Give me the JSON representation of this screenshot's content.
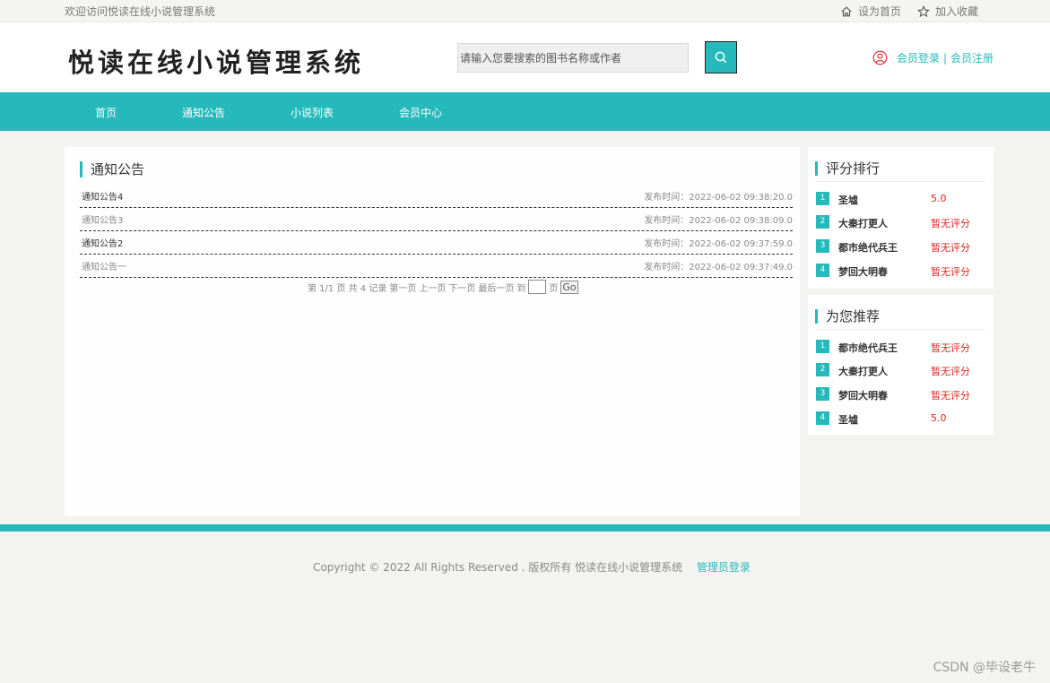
{
  "topbar": {
    "welcome": "欢迎访问悦读在线小说管理系统",
    "set_home": "设为首页",
    "bookmark": "加入收藏"
  },
  "header": {
    "logo": "悦读在线小说管理系统",
    "search_placeholder": "请输入您要搜索的图书名称或作者",
    "login": "会员登录",
    "separator": "|",
    "register": "会员注册"
  },
  "nav": {
    "items": [
      {
        "label": "首页"
      },
      {
        "label": "通知公告"
      },
      {
        "label": "小说列表"
      },
      {
        "label": "会员中心"
      }
    ]
  },
  "main": {
    "title": "通知公告",
    "notices": [
      {
        "title": "通知公告4",
        "time": "发布时间：2022-06-02 09:38:20.0",
        "color": "#333333"
      },
      {
        "title": "通知公告3",
        "time": "发布时间：2022-06-02 09:38:09.0",
        "color": "#888888"
      },
      {
        "title": "通知公告2",
        "time": "发布时间：2022-06-02 09:37:59.0",
        "color": "#333333"
      },
      {
        "title": "通知公告一",
        "time": "发布时间：2022-06-02 09:37:49.0",
        "color": "#888888"
      }
    ],
    "pager": {
      "info": "第 1/1 页 共 4 记录",
      "first": "第一页",
      "prev": "上一页",
      "next": "下一页",
      "last": "最后一页",
      "goto": "到",
      "page": "页",
      "go": "Go"
    }
  },
  "sidebar": {
    "rating": {
      "title": "评分排行",
      "items": [
        {
          "rank": "1",
          "name": "圣墟",
          "score": "5.0"
        },
        {
          "rank": "2",
          "name": "大秦打更人",
          "score": "暂无评分"
        },
        {
          "rank": "3",
          "name": "都市绝代兵王",
          "score": "暂无评分"
        },
        {
          "rank": "4",
          "name": "梦回大明春",
          "score": "暂无评分"
        }
      ]
    },
    "recommend": {
      "title": "为您推荐",
      "items": [
        {
          "rank": "1",
          "name": "都市绝代兵王",
          "score": "暂无评分"
        },
        {
          "rank": "2",
          "name": "大秦打更人",
          "score": "暂无评分"
        },
        {
          "rank": "3",
          "name": "梦回大明春",
          "score": "暂无评分"
        },
        {
          "rank": "4",
          "name": "圣墟",
          "score": "5.0"
        }
      ]
    }
  },
  "footer": {
    "copyright": "Copyright © 2022 All Rights Reserved . 版权所有  悦读在线小说管理系统",
    "admin_login": "管理员登录"
  },
  "watermark": "CSDN @毕设老牛",
  "colors": {
    "accent": "#26b9bb",
    "score": "#e0261f"
  }
}
